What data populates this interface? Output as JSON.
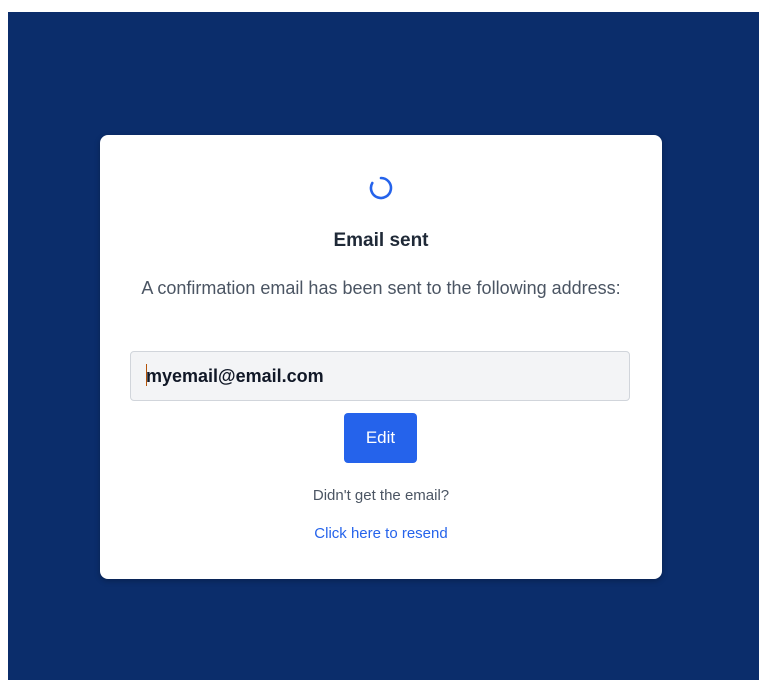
{
  "card": {
    "title": "Email sent",
    "message": "A confirmation email has been sent to the following address:",
    "email_value": "myemail@email.com",
    "edit_label": "Edit",
    "hint": "Didn't get the email?",
    "resend_label": "Click here to resend"
  },
  "icons": {
    "spinner": "loading-spinner-icon"
  },
  "colors": {
    "background": "#0b2d6b",
    "card": "#ffffff",
    "accent": "#2563eb",
    "field_background": "#f3f4f6"
  }
}
